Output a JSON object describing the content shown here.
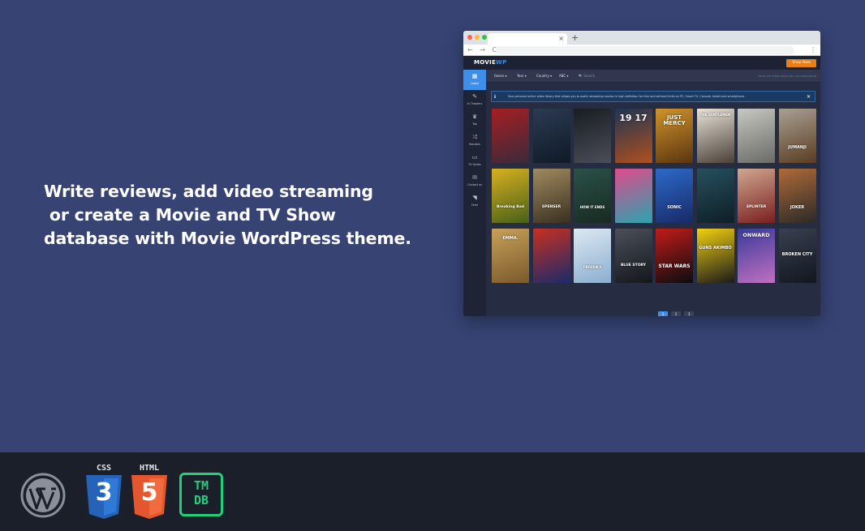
{
  "headline": {
    "line1": "Write reviews, add video streaming",
    "line2": " or create a Movie and TV Show",
    "line3": "database with Movie WordPress theme."
  },
  "browser": {
    "tab_close": "×",
    "new_tab": "+",
    "nav_buttons": "← → C",
    "addr_right": "⋮"
  },
  "app": {
    "logo_main": "MOVIE",
    "logo_accent": "WP",
    "shop_button": "Shop Now",
    "sidebar": [
      {
        "label": "Latest",
        "icon": "grid-icon",
        "glyph": "▦",
        "active": true
      },
      {
        "label": "In Theaters",
        "icon": "ticket-icon",
        "glyph": "✎",
        "active": false
      },
      {
        "label": "Top",
        "icon": "trophy-icon",
        "glyph": "♛",
        "active": false
      },
      {
        "label": "Random",
        "icon": "shuffle-icon",
        "glyph": "⤮",
        "active": false
      },
      {
        "label": "TV Series",
        "icon": "tv-icon",
        "glyph": "▭",
        "active": false
      },
      {
        "label": "Contact us",
        "icon": "mail-icon",
        "glyph": "✉",
        "active": false
      },
      {
        "label": "Feed",
        "icon": "rss-icon",
        "glyph": "◥",
        "active": false
      }
    ],
    "filters": [
      "Genre ▾",
      "Year ▾",
      "Country ▾",
      "ABC ▾"
    ],
    "search_placeholder": "🔍 Search",
    "filter_note": "MOVIE WP THEME DEMO AND DOCUMENTATION",
    "notice": "Your personal online video library that allows you to watch streaming movies in high definition for free and without limits on PC, Smart TV, Console, tablet and smartphone.",
    "notice_icon": "ℹ",
    "notice_close": "✕",
    "posters": [
      [
        {
          "title": "",
          "c1": "#a51f22",
          "c2": "#3a2a3a"
        },
        {
          "title": "",
          "c1": "#2b3b52",
          "c2": "#0f1a27"
        },
        {
          "title": "",
          "c1": "#1a1c22",
          "c2": "#4a4e58"
        },
        {
          "title": "19 17",
          "c1": "#1e3554",
          "c2": "#b0501e",
          "size": 11
        },
        {
          "title": "JUST MERCY",
          "c1": "#d0942a",
          "c2": "#5a3510",
          "size": 7
        },
        {
          "title": "THE GENTLEMEN",
          "c1": "#e9e3d8",
          "c2": "#4a4038",
          "size": 4
        },
        {
          "title": "",
          "c1": "#c8c8c2",
          "c2": "#6a6a66"
        },
        {
          "title": "JUMANJI",
          "c1": "#a9a092",
          "c2": "#5a3c22",
          "size": 5
        }
      ],
      [
        {
          "title": "Breaking Bad",
          "c1": "#d8b020",
          "c2": "#486018",
          "size": 4.5
        },
        {
          "title": "SPENSER",
          "c1": "#a08a60",
          "c2": "#3a3020",
          "size": 4.5
        },
        {
          "title": "HOW IT ENDS",
          "c1": "#2a5248",
          "c2": "#182a22",
          "size": 4
        },
        {
          "title": "",
          "c1": "#e04a8a",
          "c2": "#2aa4b0"
        },
        {
          "title": "SONIC",
          "c1": "#2c6ac8",
          "c2": "#182a68",
          "size": 5
        },
        {
          "title": "",
          "c1": "#26505e",
          "c2": "#0e1e26"
        },
        {
          "title": "SPLINTER",
          "c1": "#d0a890",
          "c2": "#7a1e1e",
          "size": 4.5
        },
        {
          "title": "JOKER",
          "c1": "#b06a38",
          "c2": "#2a2a28",
          "size": 5
        }
      ],
      [
        {
          "title": "EMMA.",
          "c1": "#c8a05a",
          "c2": "#7a5a2a",
          "size": 5
        },
        {
          "title": "",
          "c1": "#c83020",
          "c2": "#1c2a6a"
        },
        {
          "title": "FROZEN II",
          "c1": "#dde8f2",
          "c2": "#8aaed0",
          "size": 4
        },
        {
          "title": "BLUE STORY",
          "c1": "#4a505a",
          "c2": "#14161c",
          "size": 4.5
        },
        {
          "title": "STAR WARS",
          "c1": "#c01c18",
          "c2": "#0c0c10",
          "size": 6
        },
        {
          "title": "GUNS AKIMBO",
          "c1": "#f2d010",
          "c2": "#1a1a1a",
          "size": 5
        },
        {
          "title": "ONWARD",
          "c1": "#3a3a9a",
          "c2": "#c070c0",
          "size": 6.5
        },
        {
          "title": "BROKEN CITY",
          "c1": "#384050",
          "c2": "#12161e",
          "size": 5
        }
      ]
    ],
    "pages": [
      "1",
      "2",
      "3"
    ]
  },
  "footer": {
    "icons": [
      {
        "name": "wordpress-icon"
      },
      {
        "name": "css3-icon",
        "label": "CSS",
        "glyph": "3"
      },
      {
        "name": "html5-icon",
        "label": "HTML",
        "glyph": "5"
      },
      {
        "name": "tmdb-icon",
        "line1": "TM",
        "line2": "DB"
      }
    ]
  },
  "colors": {
    "background": "#364373",
    "footer": "#1b1f2a",
    "accent": "#3f8ee8",
    "shop": "#e8801a",
    "css3": "#2463b7",
    "html5": "#e4572e",
    "tmdb": "#21d07a"
  }
}
